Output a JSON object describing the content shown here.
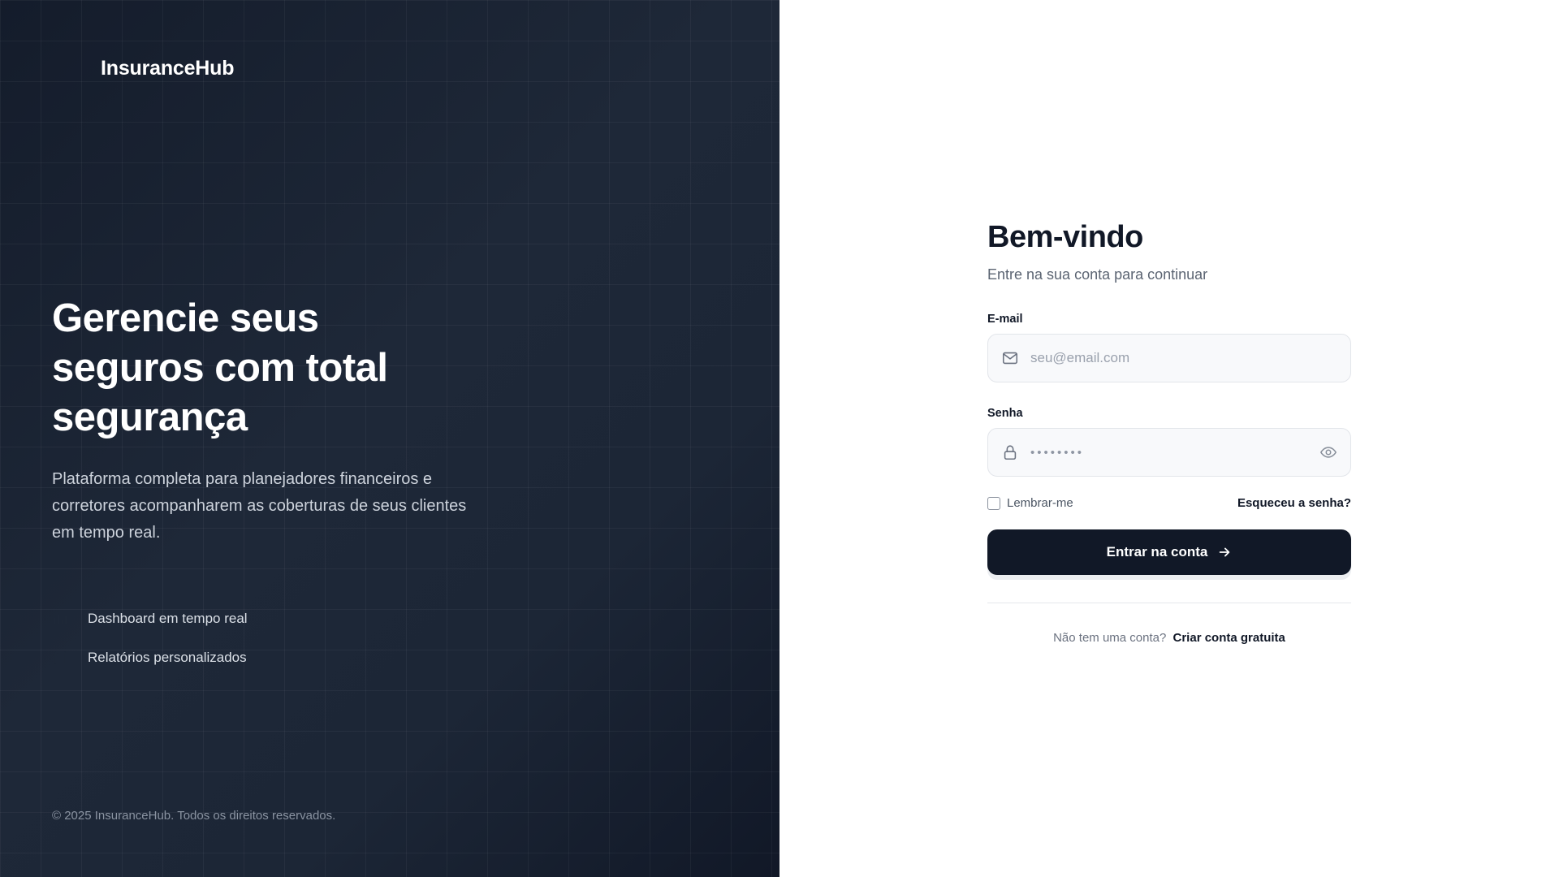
{
  "hero": {
    "brand": "InsuranceHub",
    "headline": "Gerencie seus seguros com total segurança",
    "lead": "Plataforma completa para planejadores financeiros e corretores acompanharem as coberturas de seus clientes em tempo real.",
    "features": [
      {
        "icon": "chart-icon",
        "label": "Dashboard em tempo real"
      },
      {
        "icon": "report-icon",
        "label": "Relatórios personalizados"
      }
    ],
    "copyright": "© 2025 InsuranceHub. Todos os direitos reservados."
  },
  "form": {
    "title": "Bem-vindo",
    "subtitle": "Entre na sua conta para continuar",
    "email": {
      "label": "E-mail",
      "placeholder": "seu@email.com",
      "value": "",
      "icon": "mail-icon"
    },
    "password": {
      "label": "Senha",
      "masked_value": "••••••••",
      "icon": "lock-icon",
      "toggle_icon": "eye-icon"
    },
    "remember_label": "Lembrar-me",
    "remember_checked": false,
    "forgot_label": "Esqueceu a senha?",
    "submit_label": "Entrar na conta",
    "signup_prompt": "Não tem uma conta?",
    "signup_link": "Criar conta gratuita"
  },
  "colors": {
    "hero_bg": "#1e2838",
    "primary": "#111827",
    "muted_text": "#5b6472",
    "input_bg": "#f8f9fb",
    "input_border": "#e2e5ea"
  }
}
